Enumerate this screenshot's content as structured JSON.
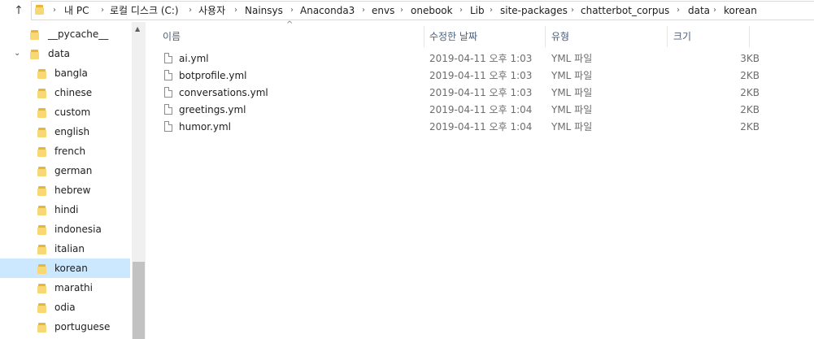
{
  "address": {
    "crumbs": [
      "내 PC",
      "로컬 디스크 (C:)",
      "사용자",
      "Nainsys",
      "Anaconda3",
      "envs",
      "onebook",
      "Lib",
      "site-packages",
      "chatterbot_corpus",
      "data",
      "korean"
    ]
  },
  "nav": {
    "items": [
      {
        "label": "__pycache__"
      },
      {
        "label": "data"
      },
      {
        "label": "bangla"
      },
      {
        "label": "chinese"
      },
      {
        "label": "custom"
      },
      {
        "label": "english"
      },
      {
        "label": "french"
      },
      {
        "label": "german"
      },
      {
        "label": "hebrew"
      },
      {
        "label": "hindi"
      },
      {
        "label": "indonesia"
      },
      {
        "label": "italian"
      },
      {
        "label": "korean"
      },
      {
        "label": "marathi"
      },
      {
        "label": "odia"
      },
      {
        "label": "portuguese"
      }
    ],
    "selected": "korean"
  },
  "columns": {
    "name": "이름",
    "date": "수정한 날짜",
    "type": "유형",
    "size": "크기"
  },
  "files": [
    {
      "name": "ai.yml",
      "date": "2019-04-11 오후 1:03",
      "type": "YML 파일",
      "size": "3KB"
    },
    {
      "name": "botprofile.yml",
      "date": "2019-04-11 오후 1:03",
      "type": "YML 파일",
      "size": "2KB"
    },
    {
      "name": "conversations.yml",
      "date": "2019-04-11 오후 1:03",
      "type": "YML 파일",
      "size": "2KB"
    },
    {
      "name": "greetings.yml",
      "date": "2019-04-11 오후 1:04",
      "type": "YML 파일",
      "size": "2KB"
    },
    {
      "name": "humor.yml",
      "date": "2019-04-11 오후 1:04",
      "type": "YML 파일",
      "size": "2KB"
    }
  ]
}
